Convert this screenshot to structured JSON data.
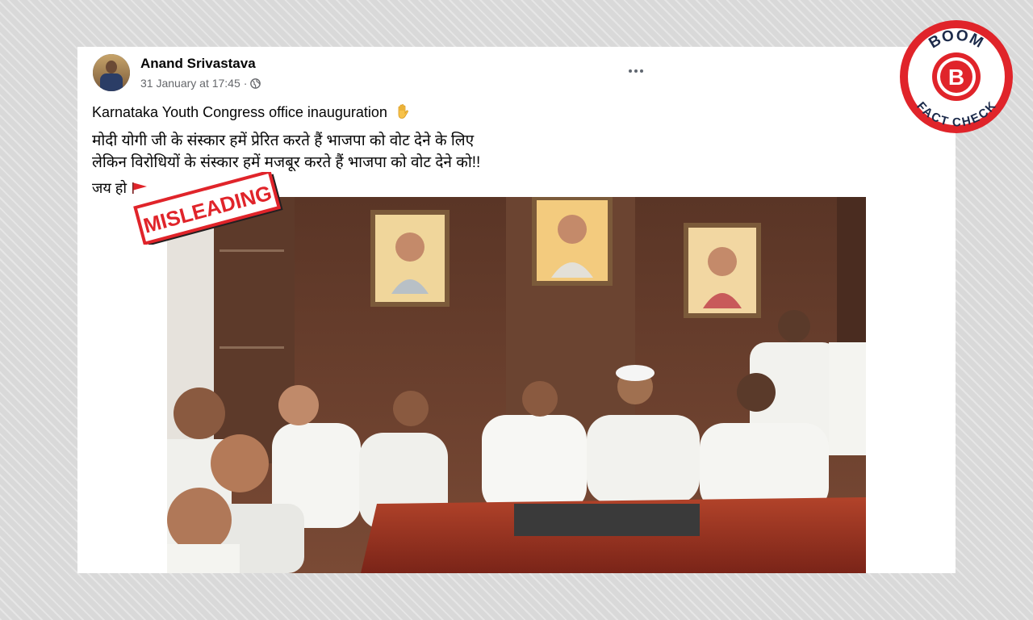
{
  "post": {
    "author": "Anand Srivastava",
    "date": "31 January at 17:45",
    "separator": "·",
    "privacy_icon": "globe-icon",
    "more_icon": "more-options-icon",
    "line1": "Karnataka Youth Congress office inauguration",
    "line1_emoji": "raised-hand-icon",
    "line2": "मोदी योगी जी के संस्कार हमें प्रेरित करते हैं भाजपा को वोट देने के लिए",
    "line3": "लेकिन विरोधियों के संस्कार हमें मजबूर करते हैं भाजपा को वोट देने को!!",
    "line4": "जय हो",
    "line4_emoji": "triangular-flag-icon"
  },
  "stamp": {
    "text": "MISLEADING",
    "color": "#e0242a"
  },
  "badge": {
    "top_text": "BOOM",
    "letter": "B",
    "bottom_text": "FACT CHECK",
    "color": "#e0242a"
  },
  "photo": {
    "description_icon": "group-photo"
  }
}
